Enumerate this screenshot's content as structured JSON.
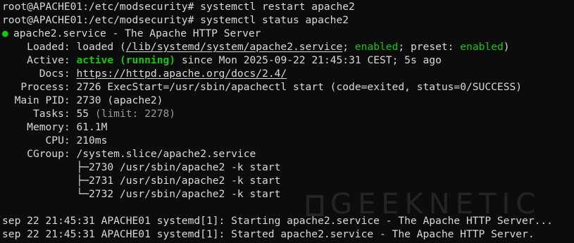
{
  "terminal": {
    "cmd1": "root@APACHE01:/etc/modsecurity# systemctl restart apache2",
    "cmd2": "root@APACHE01:/etc/modsecurity# systemctl status apache2",
    "service_header": "apache2.service - The Apache HTTP Server",
    "loaded_label": "Loaded:",
    "loaded_prefix": "loaded (",
    "loaded_path": "/lib/systemd/system/apache2.service",
    "loaded_sep1": "; ",
    "loaded_enabled": "enabled",
    "loaded_sep2": "; preset: ",
    "loaded_preset": "enabled",
    "loaded_close": ")",
    "active_label": "Active:",
    "active_state": "active (running)",
    "active_since": "since Mon 2025-09-22 21:45:31 CEST; 5s ago",
    "docs_label": "Docs:",
    "docs_url": "https://httpd.apache.org/docs/2.4/",
    "process_label": "Process:",
    "process_value": "2726 ExecStart=/usr/sbin/apachectl start (code=exited, status=0/SUCCESS)",
    "mainpid_label": "Main PID:",
    "mainpid_value": "2730 (apache2)",
    "tasks_label": "Tasks:",
    "tasks_value": "55",
    "tasks_limit": "(limit: 2278)",
    "memory_label": "Memory:",
    "memory_value": "61.1M",
    "cpu_label": "CPU:",
    "cpu_value": "210ms",
    "cgroup_label": "CGroup:",
    "cgroup_value": "/system.slice/apache2.service",
    "tree": [
      "├─2730 /usr/sbin/apache2 -k start",
      "├─2731 /usr/sbin/apache2 -k start",
      "└─2732 /usr/sbin/apache2 -k start"
    ],
    "log1": "sep 22 21:45:31 APACHE01 systemd[1]: Starting apache2.service - The Apache HTTP Server...",
    "log2": "sep 22 21:45:31 APACHE01 systemd[1]: Started apache2.service - The Apache HTTP Server."
  },
  "watermark": "GEEKNETIC",
  "colors": {
    "background": "#0c0c0c",
    "text": "#d9d9d9",
    "green": "#16c60c"
  }
}
